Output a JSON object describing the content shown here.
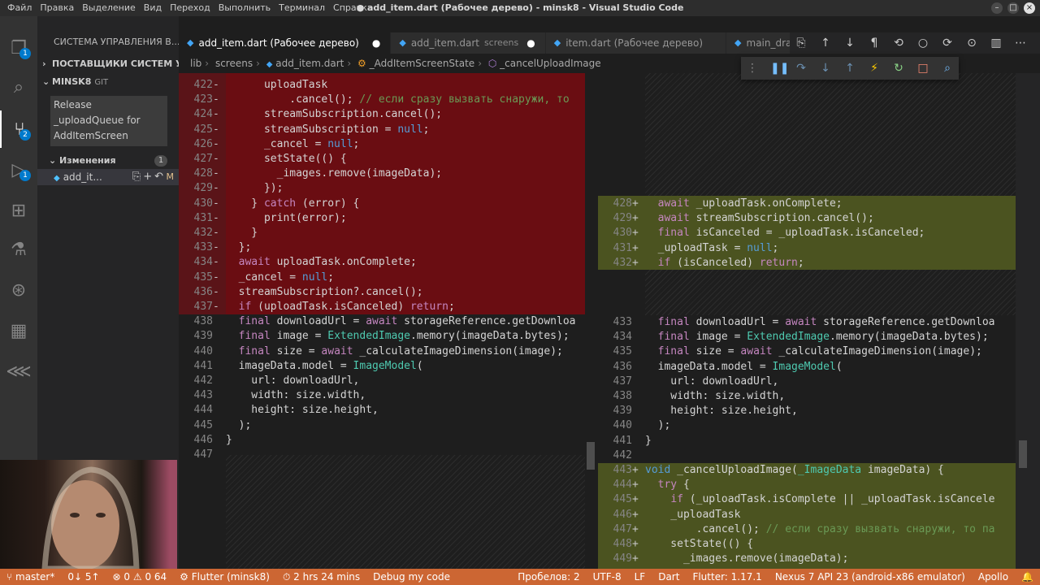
{
  "window": {
    "title": "● add_item.dart (Рабочее дерево) - minsk8 - Visual Studio Code",
    "menus": [
      "Файл",
      "Правка",
      "Выделение",
      "Вид",
      "Переход",
      "Выполнить",
      "Терминал",
      "Справка"
    ]
  },
  "activity_bar": {
    "explorer_badge": "1",
    "scm_badge": "2",
    "debug_badge": "1"
  },
  "sidebar": {
    "header": "СИСТЕМА УПРАВЛЕНИЯ В...",
    "providers": "ПОСТАВЩИКИ СИСТЕМ УП...",
    "repo": "MINSK8",
    "repo_tag": "GIT",
    "commit_message_lines": [
      "Release",
      "_uploadQueue for",
      "AddItemScreen"
    ],
    "changes_label": "Изменения",
    "changes_count": "1",
    "file_name": "add_it...",
    "file_status": "M"
  },
  "tabs": [
    {
      "label": "add_item.dart (Рабочее дерево)",
      "desc": "",
      "dirty": "●",
      "active": true
    },
    {
      "label": "add_item.dart",
      "desc": "screens",
      "dirty": "●",
      "active": false
    },
    {
      "label": "item.dart (Рабочее дерево)",
      "desc": "",
      "dirty": "",
      "active": false
    },
    {
      "label": "main_drawer",
      "desc": "",
      "dirty": "",
      "active": false
    }
  ],
  "breadcrumb": [
    "lib",
    "screens",
    "add_item.dart",
    "_AddItemScreenState",
    "_cancelUploadImage"
  ],
  "status_bar": {
    "branch": "master*",
    "sync": "0↓ 5↑",
    "problems": "⊗ 0 ⚠ 0 64",
    "flutter": "Flutter (minsk8)",
    "time": "2 hrs 24 mins",
    "debug_mode": "Debug my code",
    "spaces": "Пробелов: 2",
    "encoding": "UTF-8",
    "eol": "LF",
    "language": "Dart",
    "flutter_version": "Flutter: 1.17.1",
    "device": "Nexus 7 API 23 (android-x86 emulator)",
    "apollo": "Apollo"
  },
  "diff_left": [
    {
      "ln": "422",
      "mk": "-",
      "code": "      uploadTask"
    },
    {
      "ln": "423",
      "mk": "-",
      "code": "          .cancel(); // если сразу вызвать снаружи, то"
    },
    {
      "ln": "424",
      "mk": "-",
      "code": "      streamSubscription.cancel();"
    },
    {
      "ln": "425",
      "mk": "-",
      "code": "      streamSubscription = null;"
    },
    {
      "ln": "426",
      "mk": "-",
      "code": "      _cancel = null;"
    },
    {
      "ln": "427",
      "mk": "-",
      "code": "      setState(() {"
    },
    {
      "ln": "428",
      "mk": "-",
      "code": "        _images.remove(imageData);"
    },
    {
      "ln": "429",
      "mk": "-",
      "code": "      });"
    },
    {
      "ln": "430",
      "mk": "-",
      "code": "    } catch (error) {"
    },
    {
      "ln": "431",
      "mk": "-",
      "code": "      print(error);"
    },
    {
      "ln": "432",
      "mk": "-",
      "code": "    }"
    },
    {
      "ln": "433",
      "mk": "-",
      "code": "  };"
    },
    {
      "ln": "434",
      "mk": "-",
      "code": "  await uploadTask.onComplete;"
    },
    {
      "ln": "435",
      "mk": "-",
      "code": "  _cancel = null;"
    },
    {
      "ln": "436",
      "mk": "-",
      "code": "  streamSubscription?.cancel();"
    },
    {
      "ln": "437",
      "mk": "-",
      "code": "  if (uploadTask.isCanceled) return;"
    },
    {
      "ln": "438",
      "mk": "",
      "code": "  final downloadUrl = await storageReference.getDownloa"
    },
    {
      "ln": "439",
      "mk": "",
      "code": "  final image = ExtendedImage.memory(imageData.bytes);"
    },
    {
      "ln": "440",
      "mk": "",
      "code": "  final size = await _calculateImageDimension(image);"
    },
    {
      "ln": "441",
      "mk": "",
      "code": "  imageData.model = ImageModel("
    },
    {
      "ln": "442",
      "mk": "",
      "code": "    url: downloadUrl,"
    },
    {
      "ln": "443",
      "mk": "",
      "code": "    width: size.width,"
    },
    {
      "ln": "444",
      "mk": "",
      "code": "    height: size.height,"
    },
    {
      "ln": "445",
      "mk": "",
      "code": "  );"
    },
    {
      "ln": "446",
      "mk": "",
      "code": "}"
    },
    {
      "ln": "447",
      "mk": "",
      "code": ""
    }
  ],
  "diff_right_added": [
    {
      "ln": "428",
      "mk": "+",
      "code": "  await _uploadTask.onComplete;"
    },
    {
      "ln": "429",
      "mk": "+",
      "code": "  await streamSubscription.cancel();"
    },
    {
      "ln": "430",
      "mk": "+",
      "code": "  final isCanceled = _uploadTask.isCanceled;"
    },
    {
      "ln": "431",
      "mk": "+",
      "code": "  _uploadTask = null;"
    },
    {
      "ln": "432",
      "mk": "+",
      "code": "  if (isCanceled) return;"
    }
  ],
  "diff_right_context": [
    {
      "ln": "433",
      "mk": "",
      "code": "  final downloadUrl = await storageReference.getDownloa"
    },
    {
      "ln": "434",
      "mk": "",
      "code": "  final image = ExtendedImage.memory(imageData.bytes);"
    },
    {
      "ln": "435",
      "mk": "",
      "code": "  final size = await _calculateImageDimension(image);"
    },
    {
      "ln": "436",
      "mk": "",
      "code": "  imageData.model = ImageModel("
    },
    {
      "ln": "437",
      "mk": "",
      "code": "    url: downloadUrl,"
    },
    {
      "ln": "438",
      "mk": "",
      "code": "    width: size.width,"
    },
    {
      "ln": "439",
      "mk": "",
      "code": "    height: size.height,"
    },
    {
      "ln": "440",
      "mk": "",
      "code": "  );"
    },
    {
      "ln": "441",
      "mk": "",
      "code": "}"
    },
    {
      "ln": "442",
      "mk": "",
      "code": ""
    }
  ],
  "diff_right_added2": [
    {
      "ln": "443",
      "mk": "+",
      "code": "void _cancelUploadImage(_ImageData imageData) {"
    },
    {
      "ln": "444",
      "mk": "+",
      "code": "  try {"
    },
    {
      "ln": "445",
      "mk": "+",
      "code": "    if (_uploadTask.isComplete || _uploadTask.isCancele"
    },
    {
      "ln": "446",
      "mk": "+",
      "code": "    _uploadTask"
    },
    {
      "ln": "447",
      "mk": "+",
      "code": "        .cancel(); // если сразу вызвать снаружи, то па"
    },
    {
      "ln": "448",
      "mk": "+",
      "code": "    setState(() {"
    },
    {
      "ln": "449",
      "mk": "+",
      "code": "      _images.remove(imageData);"
    }
  ]
}
